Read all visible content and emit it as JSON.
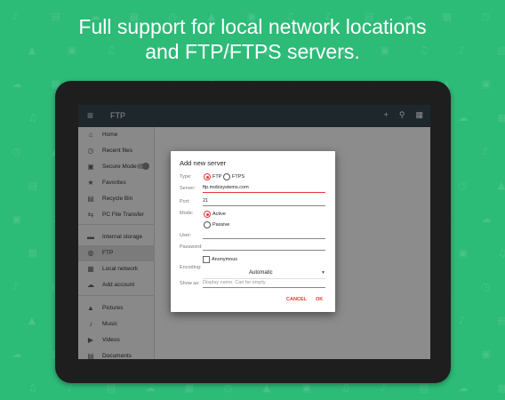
{
  "headline": {
    "line1": "Full support for local network locations",
    "line2": "and FTP/FTPS servers."
  },
  "app": {
    "title": "FTP",
    "icons": {
      "menu": "menu-icon",
      "add": "add-icon",
      "search": "search-icon",
      "view": "grid-view-icon"
    }
  },
  "drawer": {
    "items": [
      {
        "label": "Home",
        "icon": "home-icon",
        "glyph": "⌂"
      },
      {
        "label": "Recent files",
        "icon": "clock-icon",
        "glyph": "◷"
      },
      {
        "label": "Secure Mode",
        "icon": "lock-icon",
        "glyph": "▣"
      },
      {
        "label": "Favorites",
        "icon": "star-icon",
        "glyph": "★"
      },
      {
        "label": "Recycle Bin",
        "icon": "trash-icon",
        "glyph": "▤"
      },
      {
        "label": "PC File Transfer",
        "icon": "transfer-icon",
        "glyph": "⇆"
      },
      {
        "label": "Internal storage",
        "icon": "storage-icon",
        "glyph": "▬"
      },
      {
        "label": "FTP",
        "icon": "globe-icon",
        "glyph": "◍"
      },
      {
        "label": "Local network",
        "icon": "network-icon",
        "glyph": "▦"
      },
      {
        "label": "Add account",
        "icon": "cloud-add-icon",
        "glyph": "☁"
      },
      {
        "label": "Pictures",
        "icon": "image-icon",
        "glyph": "▲"
      },
      {
        "label": "Music",
        "icon": "music-icon",
        "glyph": "♪"
      },
      {
        "label": "Videos",
        "icon": "play-icon",
        "glyph": "▶"
      },
      {
        "label": "Documents",
        "icon": "document-icon",
        "glyph": "▤"
      }
    ]
  },
  "dialog": {
    "title": "Add new server",
    "type_label": "Type:",
    "type_ftp": "FTP",
    "type_ftps": "FTPS",
    "server_label": "Server:",
    "server_value": "ftp.mobisystems.com",
    "port_label": "Port:",
    "port_value": "21",
    "mode_label": "Mode:",
    "mode_active": "Active",
    "mode_passive": "Passive",
    "user_label": "User:",
    "user_value": "",
    "password_label": "Password:",
    "password_value": "",
    "anonymous_label": "Anonymous",
    "encoding_label": "Encoding:",
    "encoding_value": "Automatic",
    "showas_label": "Show as:",
    "showas_placeholder": "Display name. Can be empty.",
    "cancel_label": "CANCEL",
    "ok_label": "OK"
  },
  "colors": {
    "background": "#2dbb78",
    "accent": "#e53935",
    "appbar": "#37474f"
  }
}
